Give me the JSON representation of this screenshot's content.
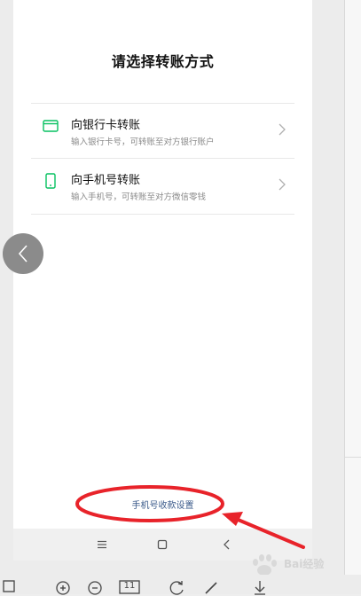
{
  "page": {
    "title": "请选择转账方式"
  },
  "options": [
    {
      "title": "向银行卡转账",
      "subtitle": "输入银行卡号，可转账至对方银行账户",
      "icon": "bank-card-icon",
      "color": "#07c160"
    },
    {
      "title": "向手机号转账",
      "subtitle": "输入手机号，可转账至对方微信零钱",
      "icon": "phone-icon",
      "color": "#07c160"
    }
  ],
  "footer": {
    "link": "手机号收款设置"
  },
  "toolbar": {
    "page_button": "11"
  },
  "watermark": {
    "text": "Bai经验"
  },
  "colors": {
    "accent": "#07c160",
    "annotation": "#e8232a",
    "link": "#3a5a8a"
  }
}
